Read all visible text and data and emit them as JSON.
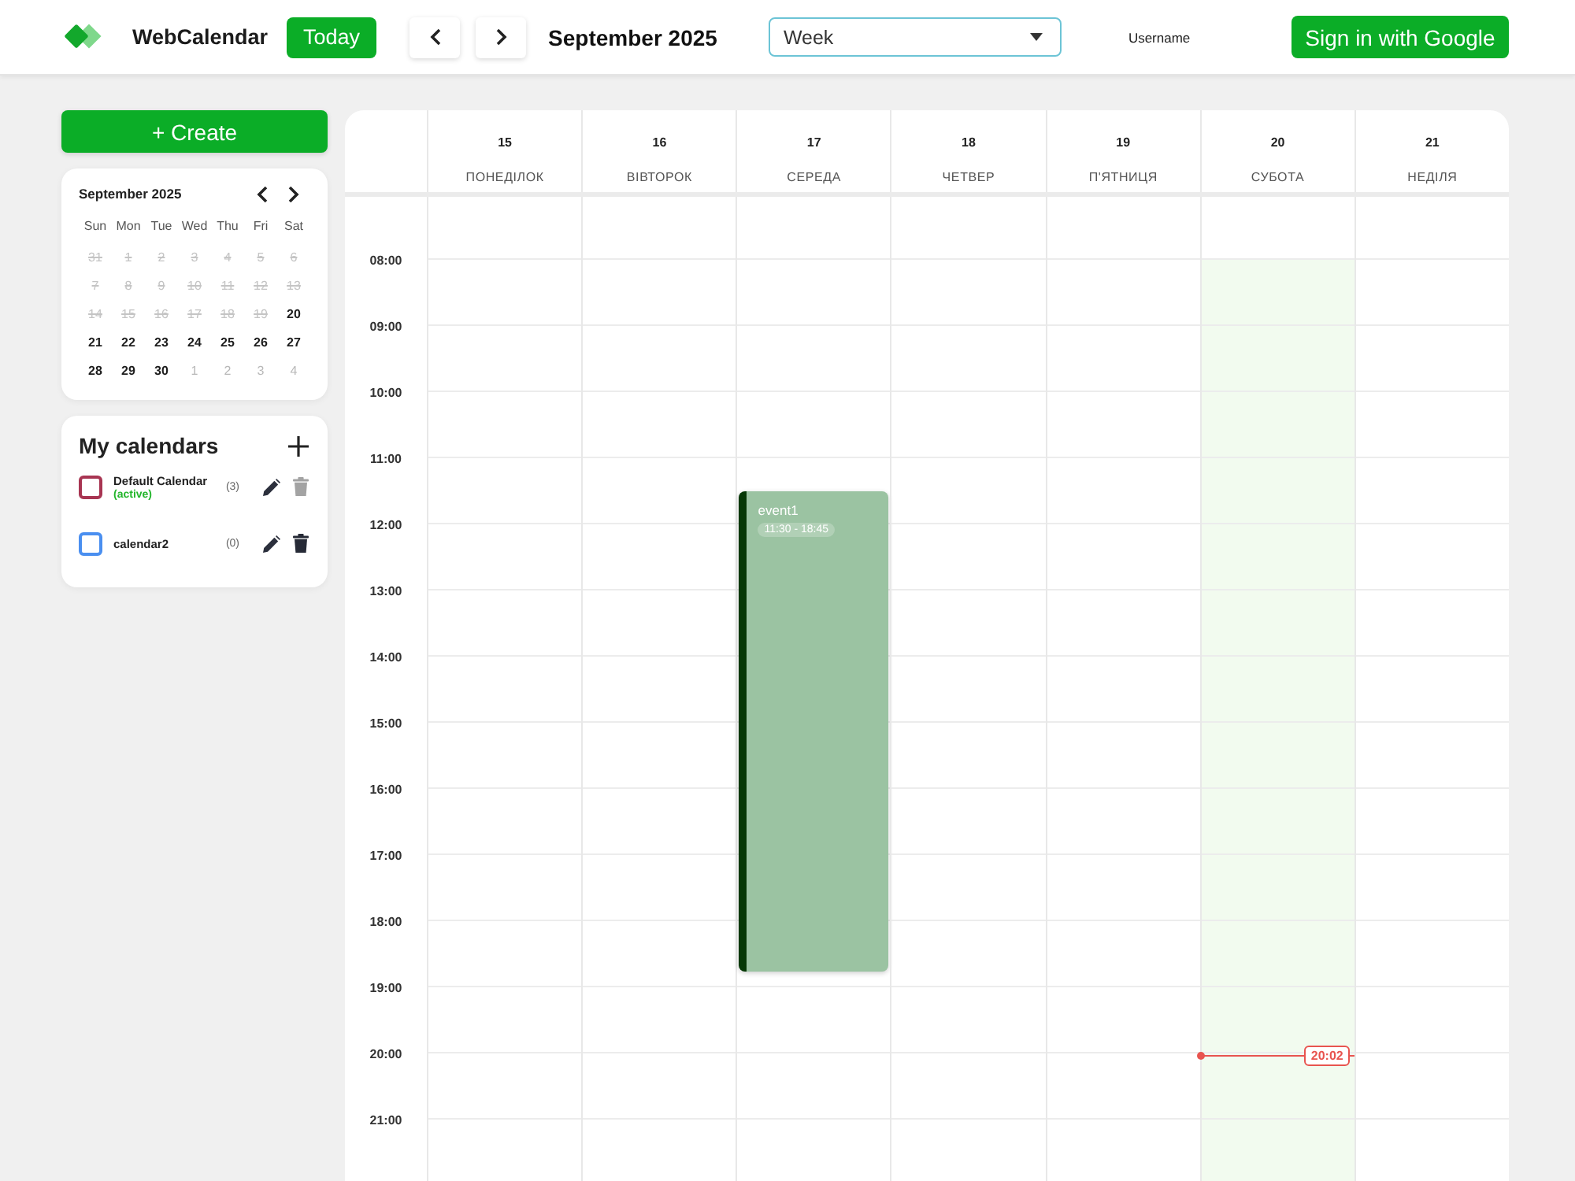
{
  "header": {
    "app_name": "WebCalendar",
    "today_button": "Today",
    "period_title": "September 2025",
    "view_select": {
      "value": "Week"
    },
    "username": "Username",
    "sign_in_button": "Sign in with Google"
  },
  "sidebar": {
    "create_button": "+ Create",
    "mini_calendar": {
      "title": "September 2025",
      "weekdays": [
        "Sun",
        "Mon",
        "Tue",
        "Wed",
        "Thu",
        "Fri",
        "Sat"
      ],
      "weeks": [
        [
          {
            "day": "31",
            "kind": "past"
          },
          {
            "day": "1",
            "kind": "past"
          },
          {
            "day": "2",
            "kind": "past"
          },
          {
            "day": "3",
            "kind": "past"
          },
          {
            "day": "4",
            "kind": "past"
          },
          {
            "day": "5",
            "kind": "past"
          },
          {
            "day": "6",
            "kind": "past"
          }
        ],
        [
          {
            "day": "7",
            "kind": "past"
          },
          {
            "day": "8",
            "kind": "past"
          },
          {
            "day": "9",
            "kind": "past"
          },
          {
            "day": "10",
            "kind": "past"
          },
          {
            "day": "11",
            "kind": "past"
          },
          {
            "day": "12",
            "kind": "past"
          },
          {
            "day": "13",
            "kind": "past"
          }
        ],
        [
          {
            "day": "14",
            "kind": "past"
          },
          {
            "day": "15",
            "kind": "past"
          },
          {
            "day": "16",
            "kind": "past"
          },
          {
            "day": "17",
            "kind": "past"
          },
          {
            "day": "18",
            "kind": "past"
          },
          {
            "day": "19",
            "kind": "past"
          },
          {
            "day": "20",
            "kind": "current"
          }
        ],
        [
          {
            "day": "21",
            "kind": "current"
          },
          {
            "day": "22",
            "kind": "current"
          },
          {
            "day": "23",
            "kind": "current"
          },
          {
            "day": "24",
            "kind": "current"
          },
          {
            "day": "25",
            "kind": "current"
          },
          {
            "day": "26",
            "kind": "current"
          },
          {
            "day": "27",
            "kind": "current"
          }
        ],
        [
          {
            "day": "28",
            "kind": "current"
          },
          {
            "day": "29",
            "kind": "current"
          },
          {
            "day": "30",
            "kind": "current"
          },
          {
            "day": "1",
            "kind": "outside"
          },
          {
            "day": "2",
            "kind": "outside"
          },
          {
            "day": "3",
            "kind": "outside"
          },
          {
            "day": "4",
            "kind": "outside"
          }
        ]
      ]
    },
    "my_calendars": {
      "title": "My calendars",
      "items": [
        {
          "name": "Default Calendar",
          "status": "(active)",
          "count": "(3)",
          "color": "#a83552",
          "checked": false,
          "delete_disabled": true
        },
        {
          "name": "calendar2",
          "count": "(0)",
          "color": "#4a8ff0",
          "checked": false,
          "delete_disabled": false
        }
      ]
    }
  },
  "week_view": {
    "hours": [
      "08:00",
      "09:00",
      "10:00",
      "11:00",
      "12:00",
      "13:00",
      "14:00",
      "15:00",
      "16:00",
      "17:00",
      "18:00",
      "19:00",
      "20:00",
      "21:00"
    ],
    "days": [
      {
        "date": "15",
        "name": "ПОНЕДІЛОК",
        "today": false
      },
      {
        "date": "16",
        "name": "ВІВТОРОК",
        "today": false
      },
      {
        "date": "17",
        "name": "СЕРЕДА",
        "today": false,
        "events": [
          {
            "title": "event1",
            "time": "11:30 - 18:45"
          }
        ]
      },
      {
        "date": "18",
        "name": "ЧЕТВЕР",
        "today": false
      },
      {
        "date": "19",
        "name": "П'ЯТНИЦЯ",
        "today": false
      },
      {
        "date": "20",
        "name": "СУБОТА",
        "today": true,
        "now_time": "20:02"
      },
      {
        "date": "21",
        "name": "НЕДІЛЯ",
        "today": false
      }
    ]
  }
}
